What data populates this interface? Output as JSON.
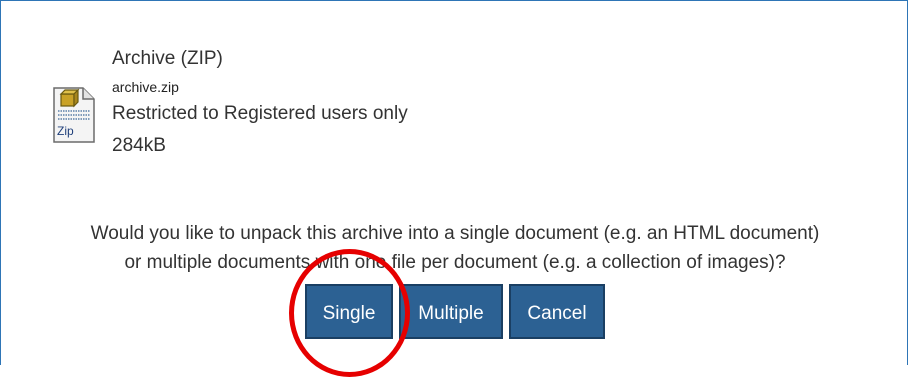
{
  "file": {
    "title": "Archive (ZIP)",
    "filename": "archive.zip",
    "restriction": "Restricted to Registered users only",
    "size": "284kB",
    "icon": "zip-file-icon",
    "icon_label": "Zip"
  },
  "prompt": {
    "line1": "Would you like to unpack this archive into a single document (e.g. an HTML document)",
    "line2": "or multiple documents with one file per document (e.g. a collection of images)?"
  },
  "buttons": {
    "single": "Single",
    "multiple": "Multiple",
    "cancel": "Cancel"
  },
  "colors": {
    "button_bg": "#2c6193",
    "frame_border": "#2e75b6",
    "highlight": "#e60000"
  }
}
